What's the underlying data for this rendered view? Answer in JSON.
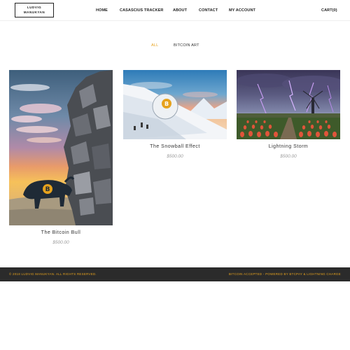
{
  "header": {
    "logo_line1": "LUDVIG",
    "logo_line2": "MANUKYAN",
    "nav": {
      "home": "HOME",
      "tracker": "CASASCIUS TRACKER",
      "about": "ABOUT",
      "contact": "CONTACT",
      "account": "MY ACCOUNT",
      "cart": "CART(0)"
    }
  },
  "filters": {
    "all": "ALL",
    "bitcoin_art": "BITCOIN ART",
    "active": "ALL"
  },
  "products": [
    {
      "title": "The Bitcoin Bull",
      "price": "$500.00"
    },
    {
      "title": "The Snowball Effect",
      "price": "$500.00"
    },
    {
      "title": "Lightning Storm",
      "price": "$500.00"
    }
  ],
  "footer": {
    "copyright": "© 2018 LUDVIG MANUKYAN. ALL RIGHTS RESERVED.",
    "powered": "BITCOIN ACCEPTED - POWERED BY BTCPAY & LIGHTNING CHARGE"
  },
  "colors": {
    "accent": "#e6a21d",
    "footer_bg": "#2b2b2b",
    "price": "#999999"
  }
}
